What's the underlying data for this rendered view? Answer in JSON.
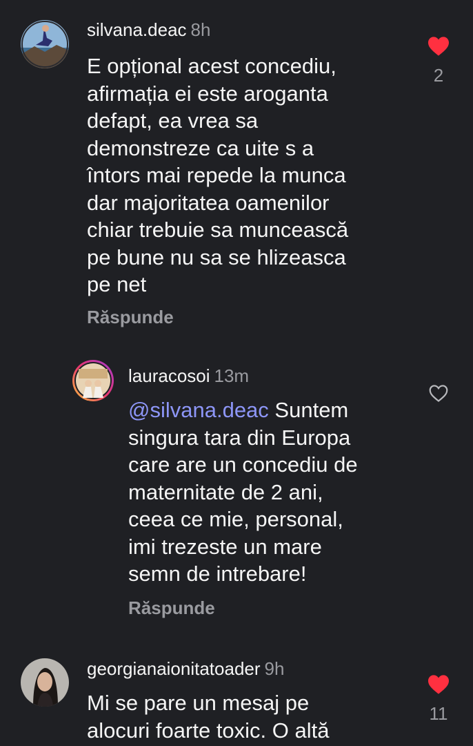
{
  "comments": [
    {
      "username": "silvana.deac",
      "time": "8h",
      "lines": [
        "E opțional acest concediu,",
        "afirmația ei este aroganta",
        "defapt, ea vrea sa",
        "demonstreze ca uite s a",
        "întors mai repede la munca",
        "dar majoritatea oamenilor",
        "chiar trebuie sa muncească",
        "pe bune nu sa se hlizeasca",
        "pe net"
      ],
      "reply_label": "Răspunde",
      "likes": "2",
      "liked": true
    },
    {
      "username": "lauracosoi",
      "time": "13m",
      "mention": "@silvana.deac",
      "first_line_rest": " Suntem",
      "lines": [
        "singura tara din Europa",
        "care are un concediu de",
        "maternitate de 2 ani,",
        "ceea ce mie, personal,",
        "imi trezeste un mare",
        "semn de intrebare!"
      ],
      "reply_label": "Răspunde",
      "liked": false
    },
    {
      "username": "georgianaionitatoader",
      "time": "9h",
      "lines": [
        "Mi se pare un mesaj pe",
        "alocuri foarte toxic. O altă"
      ],
      "likes": "11",
      "liked": true
    }
  ],
  "colors": {
    "background": "#1f2024",
    "text": "#f5f5f5",
    "secondary": "#9a9ba0",
    "mention": "#8d96f7",
    "like": "#ff3040"
  },
  "icons": {
    "liked": "heart-filled-icon",
    "not_liked": "heart-outline-icon"
  }
}
